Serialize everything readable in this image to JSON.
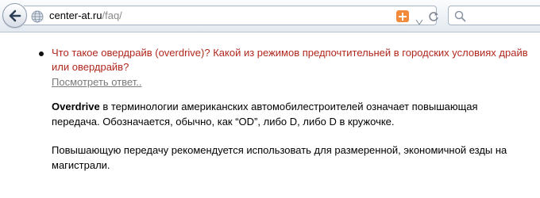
{
  "browser": {
    "url_domain": "center-at.ru",
    "url_path": "/faq/"
  },
  "faq": {
    "question": "Что такое овердрайв (overdrive)? Какой из режимов предпочтительней в городских условиях драйв или овердрайв?",
    "show_answer_label": "Посмотреть ответ..",
    "answer_term": "Overdrive",
    "answer_p1_rest": " в терминологии американских автомобилестроителей означает повышающая передача. Обозначается, обычно, как “OD”, либо D, либо D в кружочке.",
    "answer_p2": "Повышающую передачу рекомендуется использовать для размеренной, экономичной езды на магистрали."
  },
  "colors": {
    "question_text": "#b0271d",
    "link_text": "#7a7a7a",
    "addon_icon": "#f28a3c"
  },
  "icons": {
    "back": "back-arrow-icon",
    "site": "globe-icon",
    "addon": "plus-icon",
    "dropdown": "chevron-down-icon",
    "reload": "reload-icon",
    "search": "search-icon"
  }
}
